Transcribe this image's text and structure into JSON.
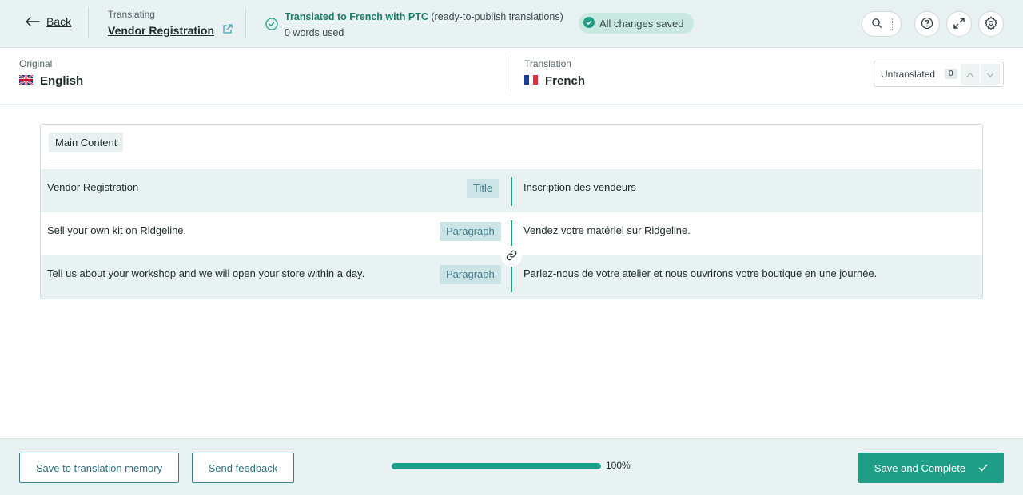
{
  "header": {
    "back_label": "Back",
    "translating_label": "Translating",
    "document_title": "Vendor Registration",
    "status_title": "Translated to French with PTC",
    "status_suffix": "(ready-to-publish translations)",
    "words_used": "0 words used",
    "saved_label": "All changes saved",
    "icons": [
      "back-arrow-icon",
      "external-link-icon",
      "check-circle-icon",
      "search-icon",
      "help-icon",
      "expand-icon",
      "gear-icon"
    ]
  },
  "languages": {
    "original_label": "Original",
    "original_name": "English",
    "translation_label": "Translation",
    "translation_name": "French",
    "filter_label": "Untranslated",
    "filter_count": "0"
  },
  "content": {
    "section_label": "Main Content",
    "rows": [
      {
        "original": "Vendor Registration",
        "type": "Title",
        "translation": "Inscription des vendeurs"
      },
      {
        "original": "Sell your own kit on Ridgeline.",
        "type": "Paragraph",
        "translation": "Vendez votre matériel sur Ridgeline."
      },
      {
        "original": "Tell us about your workshop and we will open your store within a day.",
        "type": "Paragraph",
        "translation": "Parlez-nous de votre atelier et nous ouvrirons votre boutique en une journée."
      }
    ]
  },
  "footer": {
    "save_memory_label": "Save to translation memory",
    "feedback_label": "Send feedback",
    "progress_value": 1.0,
    "progress_label": "100%",
    "complete_label": "Save and Complete"
  },
  "colors": {
    "accent": "#1e9e87",
    "header_bg": "#e9f2f2",
    "tag_bg": "#cde4e7",
    "outline_button": "#3c7f8c"
  }
}
